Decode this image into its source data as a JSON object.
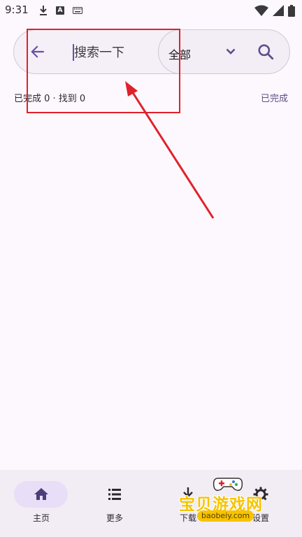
{
  "status_bar": {
    "time": "9:31",
    "left_icons": [
      "download-icon",
      "font-icon",
      "keyboard-icon"
    ],
    "right_icons": [
      "wifi-icon",
      "signal-icon",
      "battery-icon"
    ]
  },
  "search": {
    "placeholder": "搜索一下",
    "value": "",
    "filter_selected": "全部"
  },
  "summary": {
    "left": "已完成 0 · 找到 0",
    "right": "已完成"
  },
  "bottom_nav": {
    "items": [
      {
        "label": "主页",
        "icon": "home-icon",
        "active": true
      },
      {
        "label": "更多",
        "icon": "list-icon",
        "active": false
      },
      {
        "label": "下载",
        "icon": "download-icon",
        "active": false
      },
      {
        "label": "设置",
        "icon": "gear-icon",
        "active": false
      }
    ]
  },
  "watermark": {
    "text": "宝贝游戏网",
    "url": "baobeiy.com"
  },
  "colors": {
    "accent": "#6750a4",
    "annotation_red": "#e0212a",
    "background": "#fdf8fd",
    "nav_background": "#f2ecf4",
    "active_pill": "#e8def8"
  }
}
